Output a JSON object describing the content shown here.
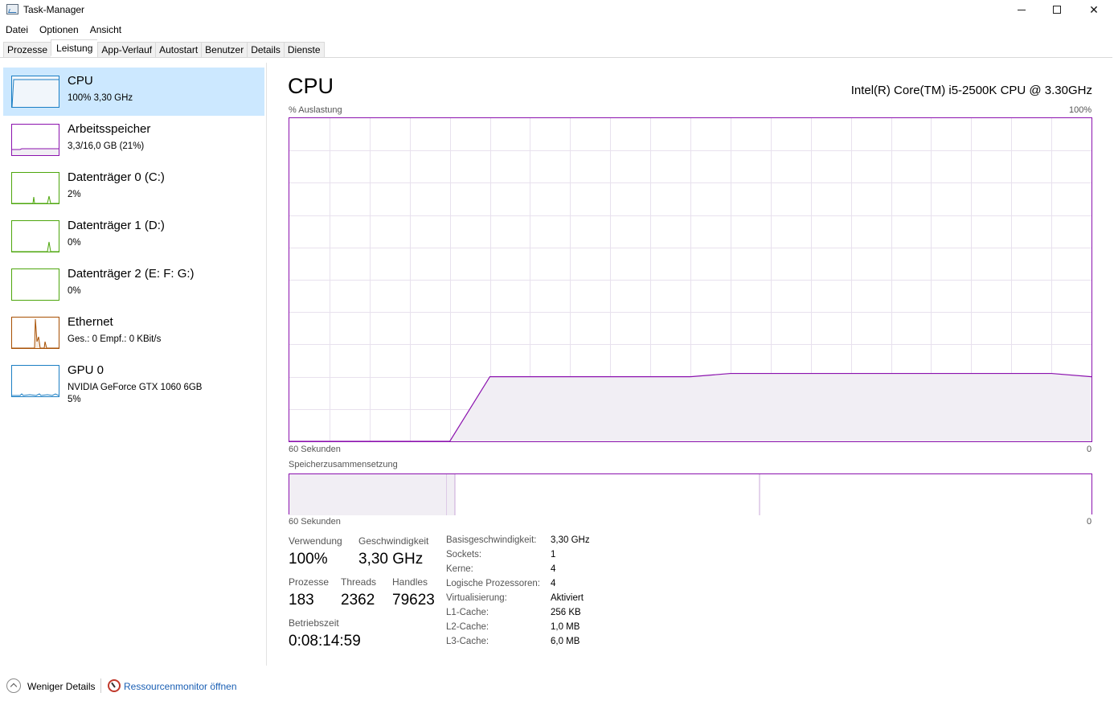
{
  "window": {
    "title": "Task-Manager"
  },
  "menu": [
    "Datei",
    "Optionen",
    "Ansicht"
  ],
  "tabs": [
    {
      "label": "Prozesse",
      "active": false
    },
    {
      "label": "Leistung",
      "active": true
    },
    {
      "label": "App-Verlauf",
      "active": false
    },
    {
      "label": "Autostart",
      "active": false
    },
    {
      "label": "Benutzer",
      "active": false
    },
    {
      "label": "Details",
      "active": false
    },
    {
      "label": "Dienste",
      "active": false
    }
  ],
  "sidebar": [
    {
      "title": "CPU",
      "sub": "100%  3,30 GHz",
      "sub2": "",
      "color": "#1c7fc4",
      "selected": true
    },
    {
      "title": "Arbeitsspeicher",
      "sub": "3,3/16,0 GB (21%)",
      "sub2": "",
      "color": "#8b12ae",
      "selected": false
    },
    {
      "title": "Datenträger 0 (C:)",
      "sub": "2%",
      "sub2": "",
      "color": "#4da60c",
      "selected": false
    },
    {
      "title": "Datenträger 1 (D:)",
      "sub": "0%",
      "sub2": "",
      "color": "#4da60c",
      "selected": false
    },
    {
      "title": "Datenträger 2 (E: F: G:)",
      "sub": "0%",
      "sub2": "",
      "color": "#4da60c",
      "selected": false
    },
    {
      "title": "Ethernet",
      "sub": "Ges.: 0  Empf.: 0 KBit/s",
      "sub2": "",
      "color": "#a74f01",
      "selected": false
    },
    {
      "title": "GPU 0",
      "sub": "NVIDIA GeForce GTX 1060 6GB",
      "sub2": "5%",
      "color": "#1c7fc4",
      "selected": false
    }
  ],
  "main": {
    "title": "CPU",
    "cpu_model": "Intel(R) Core(TM) i5-2500K CPU @ 3.30GHz",
    "graph_label": "% Auslastung",
    "graph_max": "100%",
    "time_label": "60 Sekunden",
    "time_end": "0",
    "mem_label": "Speicherzusammensetzung",
    "mem_time_label": "60 Sekunden",
    "mem_time_end": "0",
    "line_color": "#8b12ae",
    "fill_color": "#f1eef4"
  },
  "chart_data": {
    "type": "area",
    "x": [
      60,
      57,
      54,
      51,
      48,
      45,
      42,
      39,
      36,
      33,
      30,
      27,
      24,
      21,
      18,
      15,
      12,
      9,
      6,
      3,
      0
    ],
    "y": [
      0,
      0,
      0,
      0,
      0,
      20,
      20,
      20,
      20,
      20,
      20,
      21,
      21,
      21,
      21,
      21,
      21,
      21,
      21,
      21,
      20
    ],
    "ylim": [
      0,
      100
    ],
    "xlabel": "60 Sekunden",
    "ylabel": "% Auslastung"
  },
  "stats": {
    "usage_label": "Verwendung",
    "usage_value": "100%",
    "speed_label": "Geschwindigkeit",
    "speed_value": "3,30 GHz",
    "processes_label": "Prozesse",
    "processes_value": "183",
    "threads_label": "Threads",
    "threads_value": "2362",
    "handles_label": "Handles",
    "handles_value": "79623",
    "uptime_label": "Betriebszeit",
    "uptime_value": "0:08:14:59"
  },
  "details": [
    {
      "label": "Basisgeschwindigkeit:",
      "value": "3,30 GHz"
    },
    {
      "label": "Sockets:",
      "value": "1"
    },
    {
      "label": "Kerne:",
      "value": "4"
    },
    {
      "label": "Logische Prozessoren:",
      "value": "4"
    },
    {
      "label": "Virtualisierung:",
      "value": "Aktiviert"
    },
    {
      "label": "L1-Cache:",
      "value": "256 KB"
    },
    {
      "label": "L2-Cache:",
      "value": "1,0 MB"
    },
    {
      "label": "L3-Cache:",
      "value": "6,0 MB"
    }
  ],
  "footer": {
    "less_details": "Weniger Details",
    "resource_monitor": "Ressourcenmonitor öffnen"
  }
}
